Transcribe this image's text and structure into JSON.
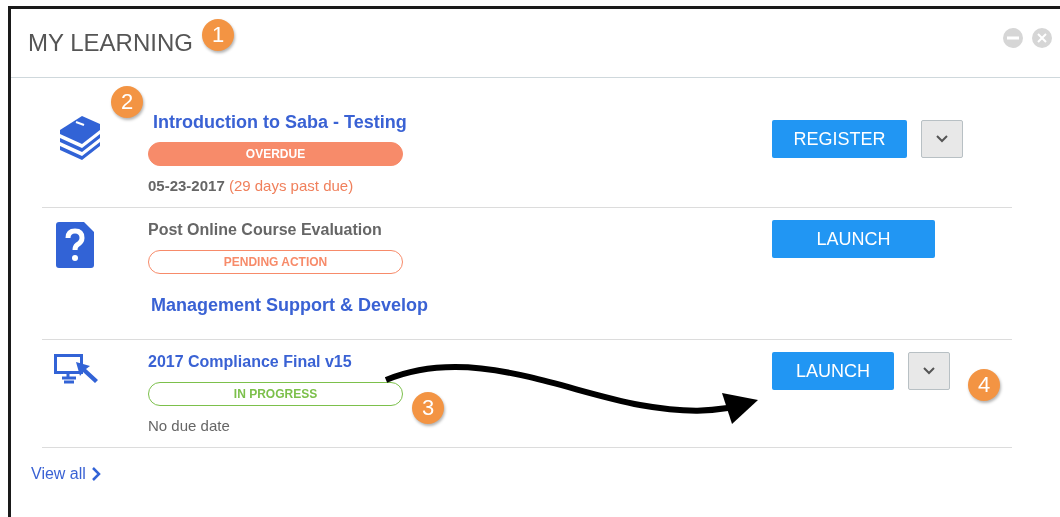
{
  "panel": {
    "title": "MY LEARNING"
  },
  "items": [
    {
      "kind": "course",
      "title": {
        "text": "Introduction to Saba - Testing"
      },
      "badge": {
        "label": "OVERDUE",
        "kind": "overdue",
        "color": "#f78b6a"
      },
      "due": {
        "kind": "overdue",
        "date": "05-23-2017",
        "note": "(29 days past due)"
      },
      "action": {
        "label": "REGISTER",
        "menu": true
      }
    },
    {
      "kind": "evaluation",
      "title": {
        "text": "Post Online Course Evaluation"
      },
      "badge": {
        "label": "PENDING ACTION",
        "kind": "pending",
        "color": "#f78b6a"
      },
      "subtitle": "Management Support & Develop",
      "action": {
        "label": "LAUNCH",
        "menu": false
      }
    },
    {
      "kind": "elearning",
      "title": {
        "text": "2017 Compliance Final v15"
      },
      "badge": {
        "label": "IN PROGRESS",
        "kind": "progress",
        "color": "#7cc04b"
      },
      "due": {
        "kind": "plain",
        "date": "No due date"
      },
      "action": {
        "label": "LAUNCH",
        "menu": true
      }
    }
  ],
  "footer": {
    "link": "View all"
  },
  "callouts": [
    {
      "label": "1"
    },
    {
      "label": "2"
    },
    {
      "label": "3"
    },
    {
      "label": "4"
    }
  ]
}
